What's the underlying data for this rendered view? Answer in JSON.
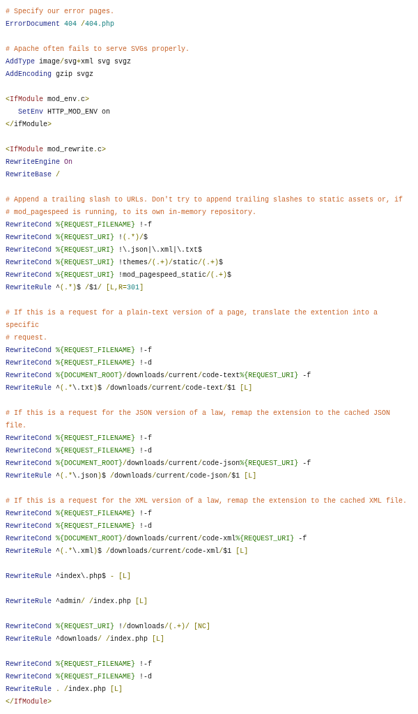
{
  "code_blocks": [
    [
      [
        {
          "kind": "comment",
          "text": "# Specify our error pages."
        }
      ],
      [
        {
          "kind": "directive",
          "text": "ErrorDocument"
        },
        {
          "kind": "number",
          "text": " 404"
        },
        {
          "kind": "punct",
          "text": " /"
        },
        {
          "kind": "number",
          "text": "404.php"
        }
      ]
    ],
    [
      [
        {
          "kind": "comment",
          "text": "# Apache often fails to serve SVGs properly."
        }
      ],
      [
        {
          "kind": "directive",
          "text": "AddType"
        },
        {
          "kind": "plain",
          "text": " image"
        },
        {
          "kind": "punct",
          "text": "/"
        },
        {
          "kind": "plain",
          "text": "svg"
        },
        {
          "kind": "punct",
          "text": "+"
        },
        {
          "kind": "plain",
          "text": "xml svg svgz"
        }
      ],
      [
        {
          "kind": "directive",
          "text": "AddEncoding"
        },
        {
          "kind": "plain",
          "text": " gzip svgz"
        }
      ]
    ],
    [
      [
        {
          "kind": "punct",
          "text": "<"
        },
        {
          "kind": "tag",
          "text": "IfModule"
        },
        {
          "kind": "plain",
          "text": " mod_env"
        },
        {
          "kind": "punct",
          "text": "."
        },
        {
          "kind": "plain",
          "text": "c"
        },
        {
          "kind": "punct",
          "text": ">"
        }
      ],
      [
        {
          "kind": "directive",
          "text": "   SetEnv"
        },
        {
          "kind": "plain",
          "text": " HTTP_MOD_ENV on"
        }
      ],
      [
        {
          "kind": "punct",
          "text": "</"
        },
        {
          "kind": "plain",
          "text": "ifModule"
        },
        {
          "kind": "punct",
          "text": ">"
        }
      ]
    ],
    [
      [
        {
          "kind": "punct",
          "text": "<"
        },
        {
          "kind": "tag",
          "text": "IfModule"
        },
        {
          "kind": "plain",
          "text": " mod_rewrite"
        },
        {
          "kind": "punct",
          "text": "."
        },
        {
          "kind": "plain",
          "text": "c"
        },
        {
          "kind": "punct",
          "text": ">"
        }
      ],
      [
        {
          "kind": "directive",
          "text": "RewriteEngine"
        },
        {
          "kind": "keyword",
          "text": " On"
        }
      ],
      [
        {
          "kind": "directive",
          "text": "RewriteBase"
        },
        {
          "kind": "punct",
          "text": " /"
        }
      ]
    ],
    [
      [
        {
          "kind": "comment",
          "text": "# Append a trailing slash to URLs. Don't try to append trailing slashes to static assets or, if"
        }
      ],
      [
        {
          "kind": "comment",
          "text": "# mod_pagespeed is running, to its own in-memory repository."
        }
      ],
      [
        {
          "kind": "directive",
          "text": "RewriteCond"
        },
        {
          "kind": "variable",
          "text": " %{REQUEST_FILENAME}"
        },
        {
          "kind": "plain",
          "text": " !-f"
        }
      ],
      [
        {
          "kind": "directive",
          "text": "RewriteCond"
        },
        {
          "kind": "variable",
          "text": " %{REQUEST_URI}"
        },
        {
          "kind": "plain",
          "text": " !"
        },
        {
          "kind": "punct",
          "text": "(.*)/"
        },
        {
          "kind": "plain",
          "text": "$"
        }
      ],
      [
        {
          "kind": "directive",
          "text": "RewriteCond"
        },
        {
          "kind": "variable",
          "text": " %{REQUEST_URI}"
        },
        {
          "kind": "plain",
          "text": " !\\.json|\\.xml|\\.txt$"
        }
      ],
      [
        {
          "kind": "directive",
          "text": "RewriteCond"
        },
        {
          "kind": "variable",
          "text": " %{REQUEST_URI}"
        },
        {
          "kind": "plain",
          "text": " !themes"
        },
        {
          "kind": "punct",
          "text": "/(.+)/"
        },
        {
          "kind": "plain",
          "text": "static"
        },
        {
          "kind": "punct",
          "text": "/(.+)"
        },
        {
          "kind": "plain",
          "text": "$"
        }
      ],
      [
        {
          "kind": "directive",
          "text": "RewriteCond"
        },
        {
          "kind": "variable",
          "text": " %{REQUEST_URI}"
        },
        {
          "kind": "plain",
          "text": " !mod_pagespeed_static"
        },
        {
          "kind": "punct",
          "text": "/(.+)"
        },
        {
          "kind": "plain",
          "text": "$"
        }
      ],
      [
        {
          "kind": "directive",
          "text": "RewriteRule"
        },
        {
          "kind": "plain",
          "text": " ^"
        },
        {
          "kind": "punct",
          "text": "(.*)"
        },
        {
          "kind": "plain",
          "text": "$"
        },
        {
          "kind": "punct",
          "text": " /"
        },
        {
          "kind": "plain",
          "text": "$1"
        },
        {
          "kind": "punct",
          "text": "/ [L,R="
        },
        {
          "kind": "number",
          "text": "301"
        },
        {
          "kind": "punct",
          "text": "]"
        }
      ]
    ],
    [
      [
        {
          "kind": "comment",
          "text": "# If this is a request for a plain-text version of a page, translate the extention into a specific"
        }
      ],
      [
        {
          "kind": "comment",
          "text": "# request."
        }
      ],
      [
        {
          "kind": "directive",
          "text": "RewriteCond"
        },
        {
          "kind": "variable",
          "text": " %{REQUEST_FILENAME}"
        },
        {
          "kind": "plain",
          "text": " !-f"
        }
      ],
      [
        {
          "kind": "directive",
          "text": "RewriteCond"
        },
        {
          "kind": "variable",
          "text": " %{REQUEST_FILENAME}"
        },
        {
          "kind": "plain",
          "text": " !-d"
        }
      ],
      [
        {
          "kind": "directive",
          "text": "RewriteCond"
        },
        {
          "kind": "variable",
          "text": " %{DOCUMENT_ROOT}"
        },
        {
          "kind": "punct",
          "text": "/"
        },
        {
          "kind": "plain",
          "text": "downloads"
        },
        {
          "kind": "punct",
          "text": "/"
        },
        {
          "kind": "plain",
          "text": "current"
        },
        {
          "kind": "punct",
          "text": "/"
        },
        {
          "kind": "plain",
          "text": "code-text"
        },
        {
          "kind": "variable",
          "text": "%{REQUEST_URI}"
        },
        {
          "kind": "plain",
          "text": " -f"
        }
      ],
      [
        {
          "kind": "directive",
          "text": "RewriteRule"
        },
        {
          "kind": "plain",
          "text": " ^"
        },
        {
          "kind": "punct",
          "text": "(.*"
        },
        {
          "kind": "plain",
          "text": "\\.txt"
        },
        {
          "kind": "punct",
          "text": ")"
        },
        {
          "kind": "plain",
          "text": "$"
        },
        {
          "kind": "punct",
          "text": " /"
        },
        {
          "kind": "plain",
          "text": "downloads"
        },
        {
          "kind": "punct",
          "text": "/"
        },
        {
          "kind": "plain",
          "text": "current"
        },
        {
          "kind": "punct",
          "text": "/"
        },
        {
          "kind": "plain",
          "text": "code-text"
        },
        {
          "kind": "punct",
          "text": "/"
        },
        {
          "kind": "plain",
          "text": "$1"
        },
        {
          "kind": "punct",
          "text": " [L]"
        }
      ]
    ],
    [
      [
        {
          "kind": "comment",
          "text": "# If this is a request for the JSON version of a law, remap the extension to the cached JSON file."
        }
      ],
      [
        {
          "kind": "directive",
          "text": "RewriteCond"
        },
        {
          "kind": "variable",
          "text": " %{REQUEST_FILENAME}"
        },
        {
          "kind": "plain",
          "text": " !-f"
        }
      ],
      [
        {
          "kind": "directive",
          "text": "RewriteCond"
        },
        {
          "kind": "variable",
          "text": " %{REQUEST_FILENAME}"
        },
        {
          "kind": "plain",
          "text": " !-d"
        }
      ],
      [
        {
          "kind": "directive",
          "text": "RewriteCond"
        },
        {
          "kind": "variable",
          "text": " %{DOCUMENT_ROOT}"
        },
        {
          "kind": "punct",
          "text": "/"
        },
        {
          "kind": "plain",
          "text": "downloads"
        },
        {
          "kind": "punct",
          "text": "/"
        },
        {
          "kind": "plain",
          "text": "current"
        },
        {
          "kind": "punct",
          "text": "/"
        },
        {
          "kind": "plain",
          "text": "code-json"
        },
        {
          "kind": "variable",
          "text": "%{REQUEST_URI}"
        },
        {
          "kind": "plain",
          "text": " -f"
        }
      ],
      [
        {
          "kind": "directive",
          "text": "RewriteRule"
        },
        {
          "kind": "plain",
          "text": " ^"
        },
        {
          "kind": "punct",
          "text": "(.*"
        },
        {
          "kind": "plain",
          "text": "\\.json"
        },
        {
          "kind": "punct",
          "text": ")"
        },
        {
          "kind": "plain",
          "text": "$"
        },
        {
          "kind": "punct",
          "text": " /"
        },
        {
          "kind": "plain",
          "text": "downloads"
        },
        {
          "kind": "punct",
          "text": "/"
        },
        {
          "kind": "plain",
          "text": "current"
        },
        {
          "kind": "punct",
          "text": "/"
        },
        {
          "kind": "plain",
          "text": "code-json"
        },
        {
          "kind": "punct",
          "text": "/"
        },
        {
          "kind": "plain",
          "text": "$1"
        },
        {
          "kind": "punct",
          "text": " [L]"
        }
      ]
    ],
    [
      [
        {
          "kind": "comment",
          "text": "# If this is a request for the XML version of a law, remap the extension to the cached XML file."
        }
      ],
      [
        {
          "kind": "directive",
          "text": "RewriteCond"
        },
        {
          "kind": "variable",
          "text": " %{REQUEST_FILENAME}"
        },
        {
          "kind": "plain",
          "text": " !-f"
        }
      ],
      [
        {
          "kind": "directive",
          "text": "RewriteCond"
        },
        {
          "kind": "variable",
          "text": " %{REQUEST_FILENAME}"
        },
        {
          "kind": "plain",
          "text": " !-d"
        }
      ],
      [
        {
          "kind": "directive",
          "text": "RewriteCond"
        },
        {
          "kind": "variable",
          "text": " %{DOCUMENT_ROOT}"
        },
        {
          "kind": "punct",
          "text": "/"
        },
        {
          "kind": "plain",
          "text": "downloads"
        },
        {
          "kind": "punct",
          "text": "/"
        },
        {
          "kind": "plain",
          "text": "current"
        },
        {
          "kind": "punct",
          "text": "/"
        },
        {
          "kind": "plain",
          "text": "code-xml"
        },
        {
          "kind": "variable",
          "text": "%{REQUEST_URI}"
        },
        {
          "kind": "plain",
          "text": " -f"
        }
      ],
      [
        {
          "kind": "directive",
          "text": "RewriteRule"
        },
        {
          "kind": "plain",
          "text": " ^"
        },
        {
          "kind": "punct",
          "text": "(.*"
        },
        {
          "kind": "plain",
          "text": "\\.xml"
        },
        {
          "kind": "punct",
          "text": ")"
        },
        {
          "kind": "plain",
          "text": "$"
        },
        {
          "kind": "punct",
          "text": " /"
        },
        {
          "kind": "plain",
          "text": "downloads"
        },
        {
          "kind": "punct",
          "text": "/"
        },
        {
          "kind": "plain",
          "text": "current"
        },
        {
          "kind": "punct",
          "text": "/"
        },
        {
          "kind": "plain",
          "text": "code-xml"
        },
        {
          "kind": "punct",
          "text": "/"
        },
        {
          "kind": "plain",
          "text": "$1"
        },
        {
          "kind": "punct",
          "text": " [L]"
        }
      ]
    ],
    [
      [
        {
          "kind": "directive",
          "text": "RewriteRule"
        },
        {
          "kind": "plain",
          "text": " ^index\\.php$"
        },
        {
          "kind": "punct",
          "text": " - [L]"
        }
      ]
    ],
    [
      [
        {
          "kind": "directive",
          "text": "RewriteRule"
        },
        {
          "kind": "plain",
          "text": " ^admin"
        },
        {
          "kind": "punct",
          "text": "/ /"
        },
        {
          "kind": "plain",
          "text": "index.php"
        },
        {
          "kind": "punct",
          "text": " [L]"
        }
      ]
    ],
    [
      [
        {
          "kind": "directive",
          "text": "RewriteCond"
        },
        {
          "kind": "variable",
          "text": " %{REQUEST_URI}"
        },
        {
          "kind": "plain",
          "text": " !"
        },
        {
          "kind": "punct",
          "text": "/"
        },
        {
          "kind": "plain",
          "text": "downloads"
        },
        {
          "kind": "punct",
          "text": "/(.+)/ [NC]"
        }
      ],
      [
        {
          "kind": "directive",
          "text": "RewriteRule"
        },
        {
          "kind": "plain",
          "text": " ^downloads"
        },
        {
          "kind": "punct",
          "text": "/ /"
        },
        {
          "kind": "plain",
          "text": "index.php"
        },
        {
          "kind": "punct",
          "text": " [L]"
        }
      ]
    ],
    [
      [
        {
          "kind": "directive",
          "text": "RewriteCond"
        },
        {
          "kind": "variable",
          "text": " %{REQUEST_FILENAME}"
        },
        {
          "kind": "plain",
          "text": " !-f"
        }
      ],
      [
        {
          "kind": "directive",
          "text": "RewriteCond"
        },
        {
          "kind": "variable",
          "text": " %{REQUEST_FILENAME}"
        },
        {
          "kind": "plain",
          "text": " !-d"
        }
      ],
      [
        {
          "kind": "directive",
          "text": "RewriteRule"
        },
        {
          "kind": "punct",
          "text": " . /"
        },
        {
          "kind": "plain",
          "text": "index.php"
        },
        {
          "kind": "punct",
          "text": " [L]"
        }
      ],
      [
        {
          "kind": "punct",
          "text": "</"
        },
        {
          "kind": "tag",
          "text": "IfModule"
        },
        {
          "kind": "punct",
          "text": ">"
        }
      ]
    ]
  ]
}
